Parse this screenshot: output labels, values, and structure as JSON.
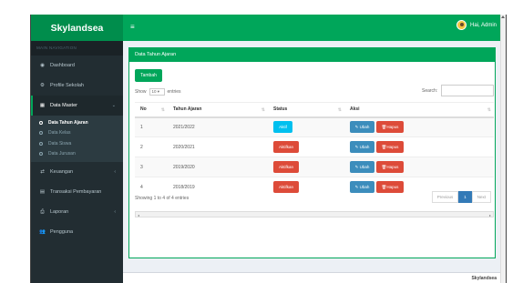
{
  "app": {
    "brand": "Skylandsea",
    "user": "Hai, Admin",
    "footer": "Skylandsea"
  },
  "sidebar": {
    "header": "MAIN NAVIGATION",
    "items": [
      {
        "label": "Dashboard",
        "icon": "dashboard-icon"
      },
      {
        "label": "Profile Sekolah",
        "icon": "gear-icon"
      },
      {
        "label": "Data Master",
        "icon": "table-icon"
      },
      {
        "label": "Keuangan",
        "icon": "exchange-icon"
      },
      {
        "label": "Transaksi Pembayaran",
        "icon": "list-icon"
      },
      {
        "label": "Laporan",
        "icon": "print-icon"
      },
      {
        "label": "Pengguna",
        "icon": "users-icon"
      }
    ],
    "submenu": [
      "Data Tahun Ajaran",
      "Data Kelas",
      "Data Siswa",
      "Data Jurusan"
    ]
  },
  "panel": {
    "title": "Data Tahun Ajaran",
    "add_label": "Tambah",
    "show_label": "Show",
    "show_value": "10",
    "entries_label": "entries",
    "search_label": "Search:"
  },
  "table": {
    "headers": [
      "No",
      "Tahun Ajaran",
      "Status",
      "Aksi"
    ],
    "rows": [
      {
        "no": "1",
        "tahun": "2021/2022",
        "status": "Aktif"
      },
      {
        "no": "2",
        "tahun": "2020/2021",
        "status": "Aktifkan"
      },
      {
        "no": "3",
        "tahun": "2019/2020",
        "status": "Aktifkan"
      },
      {
        "no": "4",
        "tahun": "2018/2019",
        "status": "Aktifkan"
      }
    ],
    "edit_label": "Ubah",
    "delete_label": "Hapus"
  },
  "pagination": {
    "info": "Showing 1 to 4 of 4 entries",
    "previous": "Previous",
    "current": "1",
    "next": "Next"
  },
  "colors": {
    "primary": "#00a65a",
    "sidebar": "#222d32",
    "info": "#00c0ef",
    "danger": "#dd4b39",
    "edit": "#3c8dbc"
  }
}
